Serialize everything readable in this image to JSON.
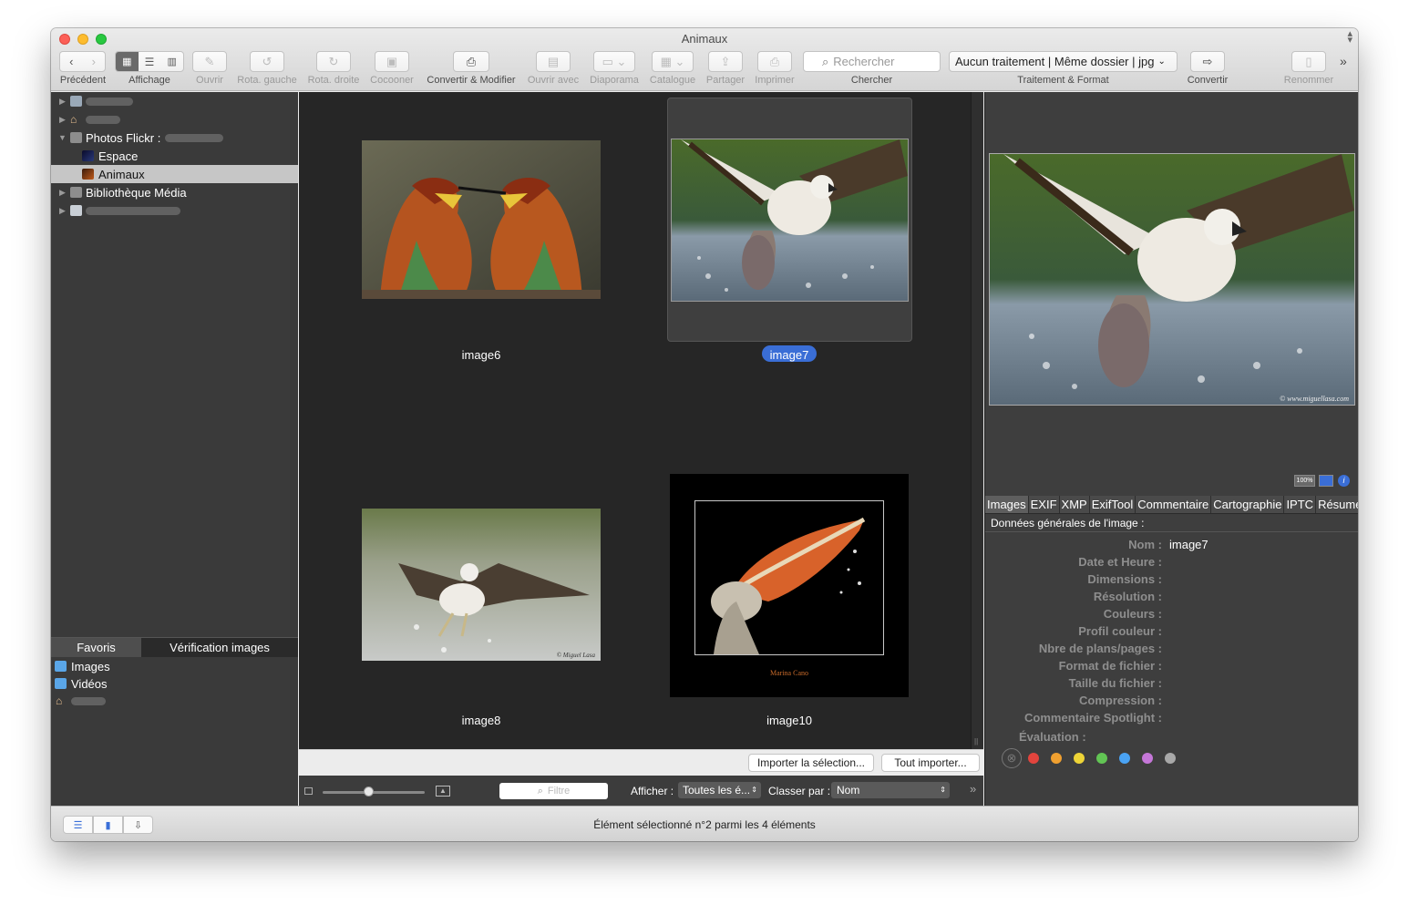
{
  "window": {
    "title": "Animaux"
  },
  "toolbar": {
    "previous_label": "Précédent",
    "view_label": "Affichage",
    "open_label": "Ouvrir",
    "rotate_left_label": "Rota. gauche",
    "rotate_right_label": "Rota. droite",
    "cocoon_label": "Cocooner",
    "convert_modify_label": "Convertir & Modifier",
    "open_with_label": "Ouvrir avec",
    "slideshow_label": "Diaporama",
    "catalog_label": "Catalogue",
    "share_label": "Partager",
    "print_label": "Imprimer",
    "search_placeholder": "Rechercher",
    "search_label": "Chercher",
    "processing_value": "Aucun traitement | Même dossier | jpg",
    "processing_label": "Traitement & Format",
    "convert_label": "Convertir",
    "rename_label": "Renommer"
  },
  "sidebar": {
    "items": [
      {
        "label": "Photos Flickr :"
      },
      {
        "label": "Espace"
      },
      {
        "label": "Animaux"
      },
      {
        "label": "Bibliothèque Média"
      }
    ]
  },
  "favorites": {
    "tabs": [
      {
        "label": "Favoris"
      },
      {
        "label": "Vérification images"
      }
    ],
    "items": [
      {
        "label": "Images"
      },
      {
        "label": "Vidéos"
      }
    ]
  },
  "grid": {
    "items": [
      {
        "label": "image6"
      },
      {
        "label": "image7"
      },
      {
        "label": "image8"
      },
      {
        "label": "image10"
      }
    ],
    "watermark_image8": "© Miguel Lasa",
    "watermark_image10": "Marina Cano"
  },
  "import": {
    "import_selection_label": "Importer la sélection...",
    "import_all_label": "Tout importer..."
  },
  "bottom": {
    "filter_placeholder": "Filtre",
    "show_label": "Afficher :",
    "show_value": "Toutes les é...",
    "sort_label": "Classer par :",
    "sort_value": "Nom"
  },
  "inspector": {
    "preview_watermark": "© www.miguellasa.com",
    "zoom_badge": "100%",
    "tabs": [
      {
        "label": "Images"
      },
      {
        "label": "EXIF"
      },
      {
        "label": "XMP"
      },
      {
        "label": "ExifTool"
      },
      {
        "label": "Commentaire"
      },
      {
        "label": "Cartographie"
      },
      {
        "label": "IPTC"
      },
      {
        "label": "Résumé"
      }
    ],
    "section_title": "Données générales de l'image :",
    "fields": [
      {
        "label": "Nom :",
        "value": "image7"
      },
      {
        "label": "Date et Heure :",
        "value": ""
      },
      {
        "label": "Dimensions :",
        "value": ""
      },
      {
        "label": "Résolution :",
        "value": ""
      },
      {
        "label": "Couleurs :",
        "value": ""
      },
      {
        "label": "Profil couleur :",
        "value": ""
      },
      {
        "label": "Nbre de plans/pages :",
        "value": ""
      },
      {
        "label": "Format de fichier :",
        "value": ""
      },
      {
        "label": "Taille du fichier :",
        "value": ""
      },
      {
        "label": "Compression :",
        "value": ""
      },
      {
        "label": "Commentaire Spotlight :",
        "value": ""
      }
    ],
    "rating_label": "Évaluation :",
    "label_colors": [
      "#e2443d",
      "#f0a030",
      "#eed437",
      "#62c554",
      "#4aa3f4",
      "#c577d8",
      "#a8a8a8"
    ]
  },
  "status": {
    "text": "Élément sélectionné n°2 parmi les 4 éléments"
  }
}
